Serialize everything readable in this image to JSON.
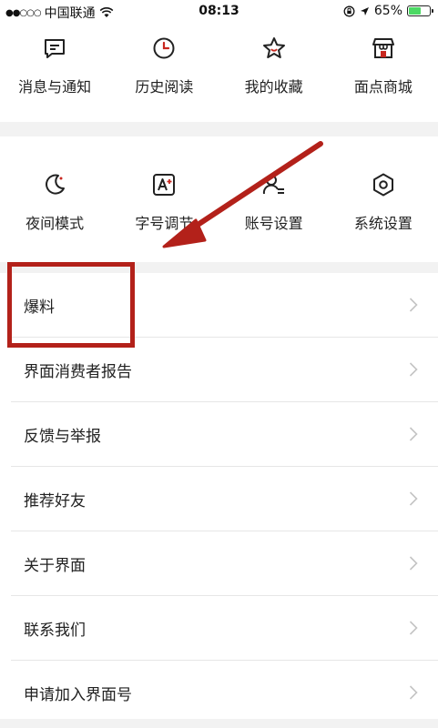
{
  "status_bar": {
    "carrier": "中国联通",
    "time": "08:13",
    "battery": "65%",
    "battery_level": 0.65
  },
  "top_menu": [
    {
      "label": "消息与通知",
      "icon": "message-icon"
    },
    {
      "label": "历史阅读",
      "icon": "clock-icon"
    },
    {
      "label": "我的收藏",
      "icon": "star-icon"
    },
    {
      "label": "面点商城",
      "icon": "store-icon"
    }
  ],
  "settings_menu": [
    {
      "label": "夜间模式",
      "icon": "moon-icon"
    },
    {
      "label": "字号调节",
      "icon": "font-size-icon"
    },
    {
      "label": "账号设置",
      "icon": "account-icon"
    },
    {
      "label": "系统设置",
      "icon": "gear-icon"
    }
  ],
  "list": [
    {
      "label": "爆料"
    },
    {
      "label": "界面消费者报告"
    },
    {
      "label": "反馈与举报"
    },
    {
      "label": "推荐好友"
    },
    {
      "label": "关于界面"
    },
    {
      "label": "联系我们"
    },
    {
      "label": "申请加入界面号"
    }
  ],
  "colors": {
    "annotation": "#b3211a",
    "background": "#ffffff",
    "separator": "#f2f2f2"
  }
}
